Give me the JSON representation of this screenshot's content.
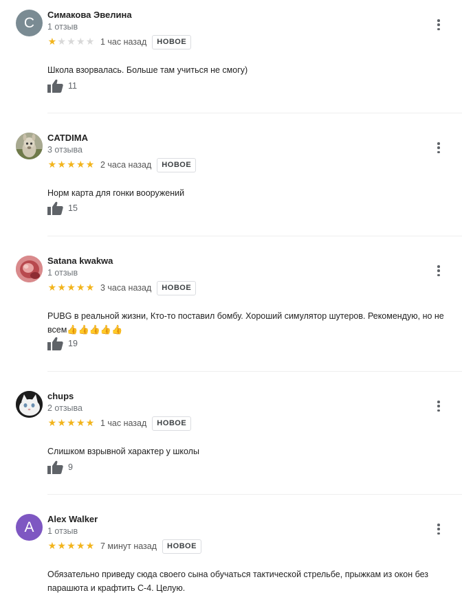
{
  "reviews": [
    {
      "author": "Симакова Эвелина",
      "review_count": "1 отзыв",
      "rating": 1,
      "time": "1 час назад",
      "badge": "НОВОЕ",
      "text": "Школа взорвалась. Больше там учиться не смогу)",
      "likes": "11",
      "avatar": {
        "type": "letter",
        "letter": "С",
        "color": "#7a8b93"
      }
    },
    {
      "author": "CATDIMA",
      "review_count": "3 отзыва",
      "rating": 5,
      "time": "2 часа назад",
      "badge": "НОВОЕ",
      "text": "Норм карта для гонки вооружений",
      "likes": "15",
      "avatar": {
        "type": "photo",
        "subject": "llama-photo"
      }
    },
    {
      "author": "Satana kwakwa",
      "review_count": "1 отзыв",
      "rating": 5,
      "time": "3 часа назад",
      "badge": "НОВОЕ",
      "text": "PUBG в реальной жизни, Кто-то поставил бомбу. Хороший симулятор шутеров. Рекомендую, но не всем",
      "emoji": "👍👍👍👍👍",
      "likes": "19",
      "avatar": {
        "type": "photo",
        "subject": "pink-closeup-photo"
      }
    },
    {
      "author": "chups",
      "review_count": "2 отзыва",
      "rating": 5,
      "time": "1 час назад",
      "badge": "НОВОЕ",
      "text": "Слишком взрывной характер у школы",
      "likes": "9",
      "avatar": {
        "type": "photo",
        "subject": "white-cat-photo"
      }
    },
    {
      "author": "Alex Walker",
      "review_count": "1 отзыв",
      "rating": 5,
      "time": "7 минут назад",
      "badge": "НОВОЕ",
      "text": "Обязательно приведу сюда своего сына обучаться тактической стрельбе, прыжкам из окон без парашюта и крафтить С-4. Целую.",
      "avatar": {
        "type": "letter",
        "letter": "A",
        "color": "#7e57c2"
      }
    }
  ],
  "colors": {
    "star_on": "#f2b41c",
    "star_off": "#d8d8d8",
    "thumb_icon": "#5f6368"
  },
  "icons": {
    "like": "thumbs-up-icon",
    "menu": "more-vert-icon",
    "star": "star-icon"
  }
}
